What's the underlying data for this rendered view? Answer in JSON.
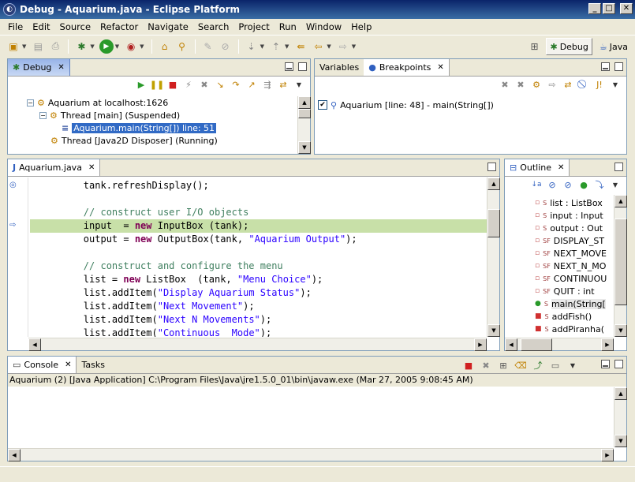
{
  "window": {
    "title": "Debug - Aquarium.java - Eclipse Platform",
    "buttons": {
      "minimize": "_",
      "maximize": "□",
      "close": "✕"
    }
  },
  "menu": [
    "File",
    "Edit",
    "Source",
    "Refactor",
    "Navigate",
    "Search",
    "Project",
    "Run",
    "Window",
    "Help"
  ],
  "perspectives": {
    "debug_label": "Debug",
    "java_label": "Java"
  },
  "debug_view": {
    "tab_label": "Debug",
    "tree": [
      {
        "text": "Aquarium at localhost:1626"
      },
      {
        "text": "Thread [main] (Suspended)"
      },
      {
        "text": "Aquarium.main(String[]) line: 51",
        "selected": true
      },
      {
        "text": "Thread [Java2D Disposer] (Running)"
      }
    ]
  },
  "variables_view": {
    "tab_variables": "Variables",
    "tab_breakpoints": "Breakpoints",
    "breakpoint": "Aquarium [line: 48] - main(String[])"
  },
  "editor": {
    "tab_label": "Aquarium.java",
    "lines": [
      [
        {
          "t": "        tank.refreshDisplay();",
          "c": ""
        }
      ],
      [
        {
          "t": " ",
          "c": ""
        }
      ],
      [
        {
          "t": "        // construct user I/O objects",
          "c": "cm"
        }
      ],
      [
        {
          "t": "        input  = ",
          "c": ""
        },
        {
          "t": "new",
          "c": "kw"
        },
        {
          "t": " InputBox (tank);",
          "c": ""
        }
      ],
      [
        {
          "t": "        output = ",
          "c": ""
        },
        {
          "t": "new",
          "c": "kw"
        },
        {
          "t": " OutputBox(tank, ",
          "c": ""
        },
        {
          "t": "\"Aquarium Output\"",
          "c": "str"
        },
        {
          "t": ");",
          "c": ""
        }
      ],
      [
        {
          "t": " ",
          "c": ""
        }
      ],
      [
        {
          "t": "        // construct and configure the menu",
          "c": "cm"
        }
      ],
      [
        {
          "t": "        list = ",
          "c": ""
        },
        {
          "t": "new",
          "c": "kw"
        },
        {
          "t": " ListBox  (tank, ",
          "c": ""
        },
        {
          "t": "\"Menu Choice\"",
          "c": "str"
        },
        {
          "t": ");",
          "c": ""
        }
      ],
      [
        {
          "t": "        list.addItem(",
          "c": ""
        },
        {
          "t": "\"Display Aquarium Status\"",
          "c": "str"
        },
        {
          "t": ");",
          "c": ""
        }
      ],
      [
        {
          "t": "        list.addItem(",
          "c": ""
        },
        {
          "t": "\"Next Movement\"",
          "c": "str"
        },
        {
          "t": ");",
          "c": ""
        }
      ],
      [
        {
          "t": "        list.addItem(",
          "c": ""
        },
        {
          "t": "\"Next N Movements\"",
          "c": "str"
        },
        {
          "t": ");",
          "c": ""
        }
      ],
      [
        {
          "t": "        list.addItem(",
          "c": ""
        },
        {
          "t": "\"Continuous  Mode\"",
          "c": "str"
        },
        {
          "t": ");",
          "c": ""
        }
      ]
    ],
    "highlighted_line_index": 3
  },
  "outline_view": {
    "tab_label": "Outline",
    "items": [
      {
        "label": "list : ListBox",
        "mod": "S",
        "kind": "field"
      },
      {
        "label": "input : Input",
        "mod": "S",
        "kind": "field"
      },
      {
        "label": "output : Out",
        "mod": "S",
        "kind": "field"
      },
      {
        "label": "DISPLAY_ST",
        "mod": "SF",
        "kind": "field"
      },
      {
        "label": "NEXT_MOVE",
        "mod": "SF",
        "kind": "field"
      },
      {
        "label": "NEXT_N_MO",
        "mod": "SF",
        "kind": "field"
      },
      {
        "label": "CONTINUOU",
        "mod": "SF",
        "kind": "field"
      },
      {
        "label": "QUIT : int",
        "mod": "SF",
        "kind": "field"
      },
      {
        "label": "main(String[",
        "mod": "S",
        "kind": "method-public"
      },
      {
        "label": "addFish()",
        "mod": "S",
        "kind": "method-private"
      },
      {
        "label": "addPiranha(",
        "mod": "S",
        "kind": "method-private"
      }
    ]
  },
  "console_view": {
    "tab_console": "Console",
    "tab_tasks": "Tasks",
    "header": "Aquarium (2) [Java Application] C:\\Program Files\\Java\\jre1.5.0_01\\bin\\javaw.exe (Mar 27, 2005 9:08:45 AM)"
  },
  "icons": {
    "close_tab": "✕",
    "minimize": "_",
    "maximize": "□"
  }
}
